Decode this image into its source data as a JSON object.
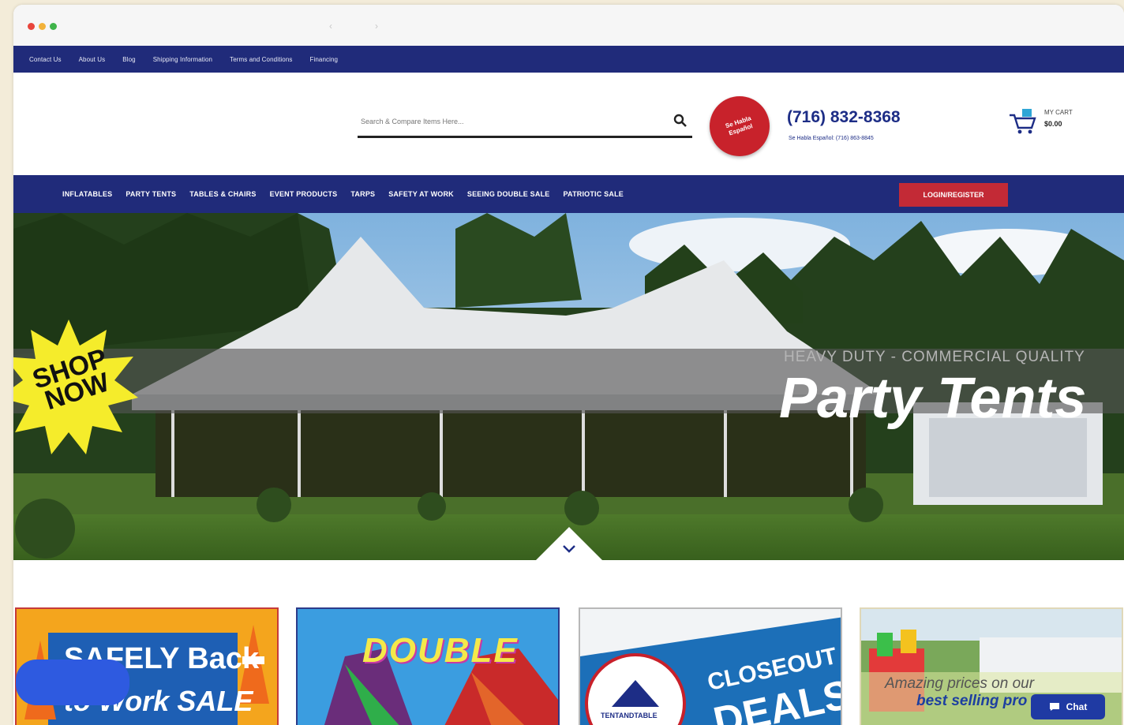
{
  "topbar": {
    "links": [
      "Contact Us",
      "About Us",
      "Blog",
      "Shipping Information",
      "Terms and Conditions",
      "Financing"
    ]
  },
  "header": {
    "search_placeholder": "Search & Compare Items Here...",
    "badge_text": "Se Habla Español",
    "phone": "(716) 832-8368",
    "phone_sub": "Se Habla Español: (716) 863-8845",
    "cart_label": "MY CART",
    "cart_total": "$0.00"
  },
  "nav": {
    "items": [
      "INFLATABLES",
      "PARTY TENTS",
      "TABLES & CHAIRS",
      "EVENT PRODUCTS",
      "TARPS",
      "SAFETY AT WORK",
      "SEEING DOUBLE SALE",
      "PATRIOTIC SALE"
    ],
    "login": "LOGIN/REGISTER"
  },
  "hero": {
    "small_text": "HEAVY DUTY - COMMERCIAL QUALITY",
    "big_text": "Party Tents",
    "shop_line1": "SHOP",
    "shop_line2": "NOW"
  },
  "cards": {
    "c1_line1": "SAFELY Back",
    "c1_line2": "to Work SALE",
    "c2_title": "DOUBLE",
    "c3_logo": "TENTANDTABLE",
    "c3_line1": "CLOSEOUT",
    "c3_line2": "DEALS",
    "c4_line1": "Amazing prices on our",
    "c4_line2": "best selling pro"
  },
  "chat": {
    "label": "Chat"
  },
  "colors": {
    "navy": "#202b7a",
    "red": "#c32a36",
    "accent_yellow": "#f5ec2b"
  }
}
